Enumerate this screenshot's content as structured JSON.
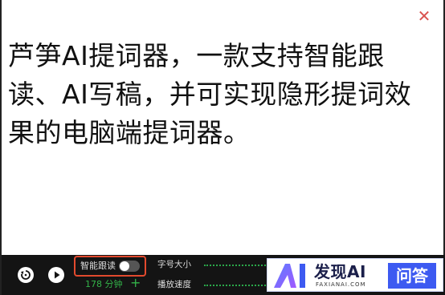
{
  "window": {
    "close_icon": "close-icon",
    "close_glyph": "✕"
  },
  "prompt": {
    "text": "芦笋AI提词器，一款支持智能跟读、AI写稿，并可实现隐形提词效果的电脑端提词器。"
  },
  "toolbar": {
    "restart_icon": "restart-icon",
    "play_icon": "play-icon",
    "smart_follow_label": "智能跟读",
    "smart_follow_on": false,
    "duration": "178 分钟",
    "add_glyph": "+",
    "font_size_label": "字号大小",
    "speed_label": "播放速度"
  },
  "watermark": {
    "brand": "发现AI",
    "domain": "FAXIANAI.COM",
    "qa": "问答"
  },
  "colors": {
    "close": "#d9534f",
    "toolbar_bg": "#141414",
    "accent_green": "#33b349",
    "highlight_box": "#e34a2e",
    "watermark_blue": "#3d5af1"
  }
}
